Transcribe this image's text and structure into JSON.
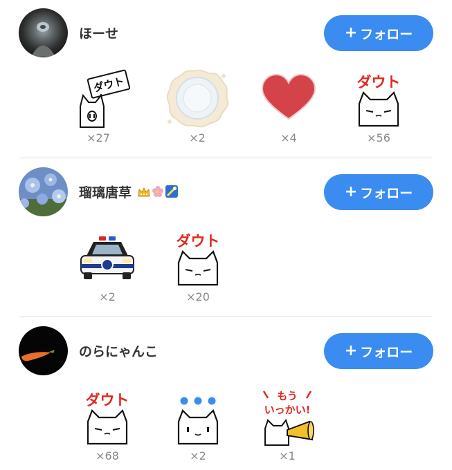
{
  "users": [
    {
      "name": "ほーせ",
      "follow_label": "フォロー",
      "reactions": [
        {
          "stamp": "dauto-sign-cat-stamp",
          "count": "×27"
        },
        {
          "stamp": "plate-splash-stamp",
          "count": "×2"
        },
        {
          "stamp": "red-heart-stamp",
          "count": "×4"
        },
        {
          "stamp": "dauto-cat-stamp",
          "count": "×56"
        }
      ]
    },
    {
      "name": "瑠璃唐草",
      "name_emojis": [
        "crown-emoji",
        "flower-emoji",
        "shooting-star-emoji"
      ],
      "follow_label": "フォロー",
      "reactions": [
        {
          "stamp": "police-car-stamp",
          "count": "×2"
        },
        {
          "stamp": "dauto-cat-stamp",
          "count": "×20"
        }
      ]
    },
    {
      "name": "のらにゃんこ",
      "follow_label": "フォロー",
      "reactions": [
        {
          "stamp": "dauto-cat-stamp",
          "count": "×68"
        },
        {
          "stamp": "ellipsis-cat-stamp",
          "count": "×2"
        },
        {
          "stamp": "mou-ikkai-megaphone-cat-stamp",
          "count": "×1"
        }
      ]
    }
  ],
  "stamp_text": {
    "dauto": "ダウト",
    "mou": "もう",
    "ikkai": "いっかい!"
  },
  "colors": {
    "follow_button": "#3a8cf0",
    "dauto_red": "#e0281e",
    "heart_red": "#d4424a",
    "count_gray": "#888888"
  }
}
